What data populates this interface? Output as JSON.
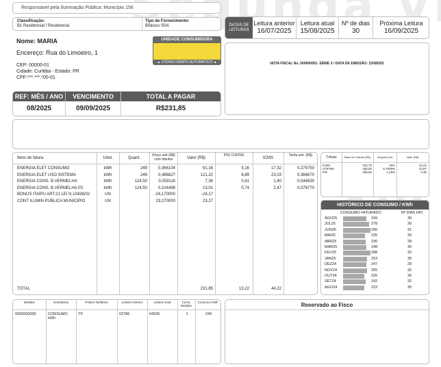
{
  "top_note": "Responsável pela Iluminação Pública: Município 156",
  "watermark": "Segunda Via",
  "classification": {
    "label": "Classificação:",
    "value": "B1 Residencial / Residencial"
  },
  "supply_type": {
    "label": "Tipo de Fornecimento:",
    "value": "Bifásico /50A"
  },
  "reading_header": {
    "dates_label_1": "DATAS DE",
    "dates_label_2": "LEITURAS",
    "prev_label": "Leitura anterior",
    "prev_value": "16/07/2025",
    "curr_label": "Leitura atual",
    "curr_value": "15/08/2025",
    "days_label": "Nº de dias",
    "days_value": "30",
    "next_label": "Próxima Leitura",
    "next_value": "16/09/2025"
  },
  "customer": {
    "name": "Nome: MARIA",
    "address": "Encereço: Rua do Limoeiro, 1",
    "cep": "CEP: 00000-01",
    "city": "Cidade: Curitiba - Estado: PR",
    "cpf": "CPF:***.***.*00-01"
  },
  "unit": {
    "title": "UNIDADE CONSUMIDORA",
    "note": "▲ CÓDIGO DÉBITO AUTOMÁTICO ▲",
    "accent": "#f5d83a"
  },
  "invoice_note": "NOTA FISCAL No. 000000001- SÉRIE 3 / DATA DE EMISSÃO: 15/08/202",
  "billing": {
    "ref_label": "REF: MÊS / ANO",
    "ref_value": "08/2025",
    "due_label": "VENCIMENTO",
    "due_value": "09/09/2025",
    "total_label": "TOTAL A PAGAR",
    "total_value": "R$231,85"
  },
  "items_table": {
    "headers": [
      "Itens de fatura",
      "Unid.",
      "Quant.",
      "Preço unit (R$) com tributos",
      "Valor (R$)",
      "PIS/ COFINS",
      "ICMS",
      "Tarifa unit. (R$)"
    ],
    "rows": [
      [
        "ENERGIA ELET CONSUMO",
        "kWh",
        "249",
        "0,366104",
        "91,16",
        "5,16",
        "17,32",
        "0,275750"
      ],
      [
        "ENERGIA ELET USO SISTEMA",
        "kWh",
        "249",
        "0,486827",
        "121,22",
        "6,89",
        "23,03",
        "0,366670"
      ],
      [
        "ENERGIA CONS. B.VERMELHA",
        "kWh",
        "124,50",
        "0,059116",
        "7,36",
        "0,41",
        "1,40",
        "0,044630"
      ],
      [
        "ENERGIA CONS. B.VERMELHA P2",
        "kWh",
        "124,50",
        "0,104498",
        "13,01",
        "0,74",
        "2,47",
        "0,078770"
      ],
      [
        "BONUS ITAIPU ART.21 LEI N.10438/02",
        "UN",
        "",
        "-24,170000",
        "-24,17",
        "",
        "",
        ""
      ],
      [
        "CONT ILUMIN PUBLICA MUNICIPIO",
        "UN",
        "",
        "23,270000",
        "23,27",
        "",
        "",
        ""
      ]
    ],
    "total_label": "TOTAL",
    "total_value": "231,85",
    "total_pis": "13,22",
    "total_icms": "44,22"
  },
  "tax_table": {
    "headers": [
      "Tributo",
      "Base de Cálculo (R$)",
      "Alíquota (%)",
      "Valor (R$)"
    ],
    "rows": [
      [
        "ICMS",
        "232,75",
        "19%",
        "44,22"
      ],
      [
        "COFINS",
        "188,50",
        "5,7609%",
        "10,87"
      ],
      [
        "PIS",
        "188,50",
        "1,25%",
        "2,35"
      ]
    ]
  },
  "history": {
    "title": "HISTÓRICO DE CONSUMO / KWh",
    "col_consumo": "CONSUMO FATURADO",
    "col_dias": "Nº DIAS FAT.",
    "rows": [
      {
        "month": "AGO25",
        "kwh": 249,
        "days": "30"
      },
      {
        "month": "JUL25",
        "kwh": 278,
        "days": "30"
      },
      {
        "month": "JUN25",
        "kwh": 290,
        "days": "31"
      },
      {
        "month": "MAI25",
        "kwh": 235,
        "days": "30"
      },
      {
        "month": "ABR25",
        "kwh": 236,
        "days": "28"
      },
      {
        "month": "MAR25",
        "kwh": 248,
        "days": "30"
      },
      {
        "month": "FEV25",
        "kwh": 288,
        "days": "32"
      },
      {
        "month": "JAN25",
        "kwh": 253,
        "days": "30"
      },
      {
        "month": "DEZ24",
        "kwh": 247,
        "days": "29"
      },
      {
        "month": "NOV24",
        "kwh": 255,
        "days": "32"
      },
      {
        "month": "OUT24",
        "kwh": 226,
        "days": "30"
      },
      {
        "month": "SET24",
        "kwh": 242,
        "days": "32"
      },
      {
        "month": "AGO24",
        "kwh": 222,
        "days": "30"
      }
    ]
  },
  "meter_table": {
    "headers": [
      "Medidor",
      "Grandezas",
      "Postos Tarifários",
      "Leitura Anterior",
      "Leitura Atual",
      "Const. Medidor",
      "Consumo kWh"
    ],
    "row": [
      "0000000000",
      "CONSUMO kWh",
      "TP",
      "63786",
      "64035",
      "1",
      "249"
    ]
  },
  "fisco_label": "Reservado ao Fisco"
}
